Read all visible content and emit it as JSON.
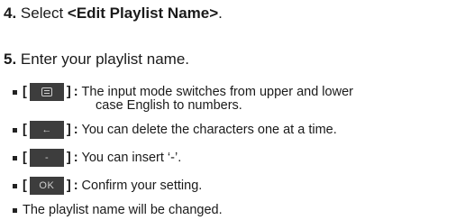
{
  "step4": {
    "number": "4.",
    "text_before": "Select ",
    "emphasis": "<Edit Playlist Name>",
    "text_after": "."
  },
  "step5": {
    "number": "5.",
    "text": "Enter your playlist name."
  },
  "items": [
    {
      "key_icon": "menu-icon",
      "key_text": "",
      "description": "The input mode switches from upper and lower",
      "description_cont": "case English to numbers."
    },
    {
      "key_icon": "back-arrow-icon",
      "key_text": "←",
      "description": "You can delete the characters one at a time."
    },
    {
      "key_icon": "dash-icon",
      "key_text": "-",
      "description": "You can insert ‘-’."
    },
    {
      "key_icon": "ok-icon",
      "key_text": "OK",
      "description": "Confirm your setting."
    }
  ],
  "note": "The playlist name will be changed.",
  "brackets": {
    "open": "[",
    "close": "]",
    "colon": ":"
  },
  "colors": {
    "key_bg": "#3d3d3d",
    "text": "#1a1a1a"
  }
}
